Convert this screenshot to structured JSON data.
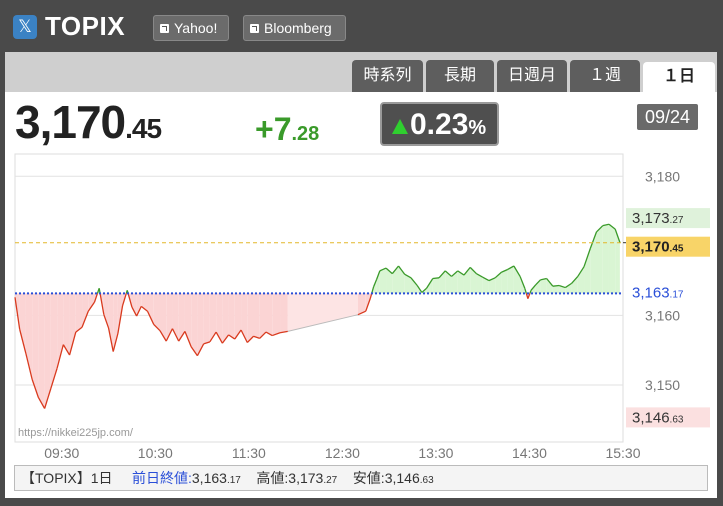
{
  "header": {
    "title": "TOPIX",
    "links": [
      {
        "label": "Yahoo!"
      },
      {
        "label": "Bloomberg"
      }
    ]
  },
  "tabs": [
    {
      "label": "時系列",
      "active": false
    },
    {
      "label": "長期",
      "active": false
    },
    {
      "label": "日週月",
      "active": false
    },
    {
      "label": "１週",
      "active": false
    },
    {
      "label": "１日",
      "active": true
    }
  ],
  "quote": {
    "price_int": "3,170",
    "price_dec": ".45",
    "change_int": "+7",
    "change_dec": ".28",
    "change_pct": "0.23",
    "pct_symbol": "%",
    "date": "09/24"
  },
  "colors": {
    "up": "#3a9a2a",
    "down": "#d93a1e",
    "prev_close": "#2a4fd8",
    "current": "#e3b72a"
  },
  "watermark": "https://nikkei225jp.com/",
  "chart_data": {
    "type": "area",
    "x_ticks": [
      "09:30",
      "10:30",
      "11:30",
      "12:30",
      "13:30",
      "14:30",
      "15:30"
    ],
    "y_ticks": [
      "3,180",
      "3,160",
      "3,150"
    ],
    "y_tick_values": [
      3180,
      3160,
      3150
    ],
    "ylim": [
      3141.8,
      3183.2
    ],
    "xlim_minutes": [
      540,
      930
    ],
    "baseline": 3163.17,
    "labels": [
      {
        "int": "3,173",
        "dec": ".27",
        "value": 3173.27,
        "kind": "high"
      },
      {
        "int": "3,170",
        "dec": ".45",
        "value": 3170.45,
        "kind": "current"
      },
      {
        "int": "3,163",
        "dec": ".17",
        "value": 3163.17,
        "kind": "prev"
      },
      {
        "int": "3,146",
        "dec": ".63",
        "value": 3146.63,
        "kind": "low"
      }
    ],
    "series_points": [
      [
        540,
        3162.6
      ],
      [
        543,
        3158.0
      ],
      [
        547,
        3154.5
      ],
      [
        551,
        3150.8
      ],
      [
        555,
        3148.2
      ],
      [
        559,
        3146.6
      ],
      [
        563,
        3149.5
      ],
      [
        567,
        3152.4
      ],
      [
        571,
        3155.8
      ],
      [
        575,
        3154.3
      ],
      [
        579,
        3157.6
      ],
      [
        583,
        3158.3
      ],
      [
        587,
        3160.6
      ],
      [
        591,
        3161.9
      ],
      [
        594,
        3163.9
      ],
      [
        597,
        3160.1
      ],
      [
        600,
        3158.2
      ],
      [
        603,
        3154.8
      ],
      [
        606,
        3157.4
      ],
      [
        609,
        3161.4
      ],
      [
        612,
        3163.6
      ],
      [
        615,
        3161.2
      ],
      [
        618,
        3159.9
      ],
      [
        621,
        3161.3
      ],
      [
        625,
        3160.6
      ],
      [
        629,
        3158.7
      ],
      [
        633,
        3157.8
      ],
      [
        637,
        3156.3
      ],
      [
        641,
        3158.1
      ],
      [
        645,
        3156.3
      ],
      [
        649,
        3157.7
      ],
      [
        653,
        3155.5
      ],
      [
        657,
        3154.2
      ],
      [
        661,
        3155.9
      ],
      [
        665,
        3156.2
      ],
      [
        669,
        3157.6
      ],
      [
        673,
        3156.0
      ],
      [
        677,
        3157.2
      ],
      [
        681,
        3156.6
      ],
      [
        685,
        3157.9
      ],
      [
        689,
        3156.1
      ],
      [
        693,
        3157.0
      ],
      [
        697,
        3156.7
      ],
      [
        701,
        3157.6
      ],
      [
        705,
        3157.1
      ],
      [
        710,
        3157.5
      ],
      [
        715,
        3157.7
      ],
      [
        760,
        3160.1
      ],
      [
        765,
        3160.6
      ],
      [
        768,
        3162.5
      ],
      [
        770,
        3164.1
      ],
      [
        772,
        3165.2
      ],
      [
        774,
        3166.4
      ],
      [
        778,
        3166.8
      ],
      [
        782,
        3166.0
      ],
      [
        786,
        3167.1
      ],
      [
        790,
        3165.9
      ],
      [
        794,
        3165.4
      ],
      [
        798,
        3164.3
      ],
      [
        801,
        3163.3
      ],
      [
        804,
        3163.9
      ],
      [
        808,
        3165.3
      ],
      [
        812,
        3165.4
      ],
      [
        816,
        3166.4
      ],
      [
        820,
        3165.6
      ],
      [
        824,
        3166.4
      ],
      [
        828,
        3165.8
      ],
      [
        832,
        3166.9
      ],
      [
        836,
        3166.0
      ],
      [
        840,
        3165.5
      ],
      [
        844,
        3165.0
      ],
      [
        848,
        3165.4
      ],
      [
        852,
        3166.2
      ],
      [
        856,
        3166.6
      ],
      [
        860,
        3167.1
      ],
      [
        864,
        3165.6
      ],
      [
        867,
        3163.9
      ],
      [
        869,
        3162.4
      ],
      [
        871,
        3163.6
      ],
      [
        874,
        3164.4
      ],
      [
        877,
        3165.1
      ],
      [
        881,
        3165.3
      ],
      [
        885,
        3164.2
      ],
      [
        889,
        3164.3
      ],
      [
        893,
        3164.0
      ],
      [
        897,
        3164.6
      ],
      [
        901,
        3165.6
      ],
      [
        905,
        3167.0
      ],
      [
        909,
        3169.6
      ],
      [
        913,
        3172.0
      ],
      [
        917,
        3172.9
      ],
      [
        921,
        3173.1
      ],
      [
        925,
        3172.4
      ],
      [
        928,
        3170.5
      ]
    ]
  },
  "footer": {
    "name": "【TOPIX】1日",
    "prev_label": "前日終値:",
    "prev_int": "3,163",
    "prev_dec": ".17",
    "high_label": "高値:",
    "high_int": "3,173",
    "high_dec": ".27",
    "low_label": "安値:",
    "low_int": "3,146",
    "low_dec": ".63"
  }
}
